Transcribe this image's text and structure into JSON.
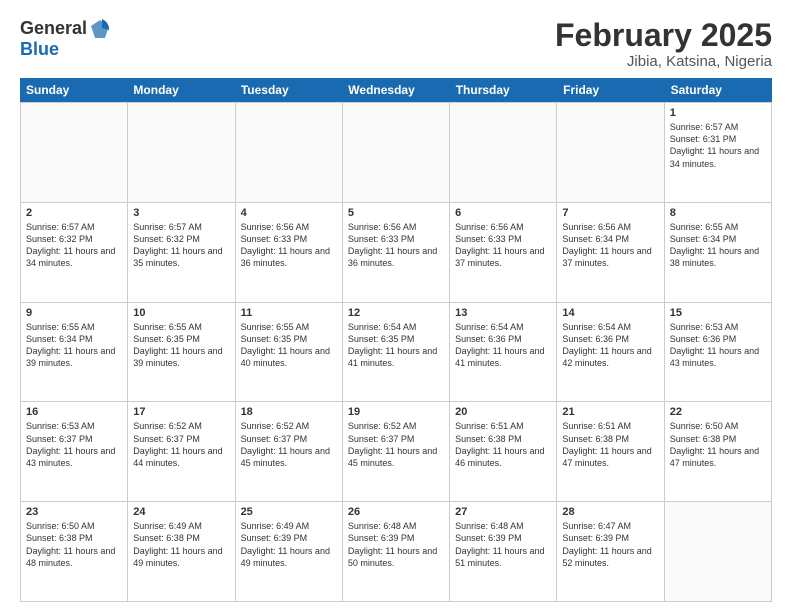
{
  "header": {
    "logo_general": "General",
    "logo_blue": "Blue",
    "month_title": "February 2025",
    "location": "Jibia, Katsina, Nigeria"
  },
  "days_of_week": [
    "Sunday",
    "Monday",
    "Tuesday",
    "Wednesday",
    "Thursday",
    "Friday",
    "Saturday"
  ],
  "weeks": [
    [
      {
        "day": "",
        "empty": true
      },
      {
        "day": "",
        "empty": true
      },
      {
        "day": "",
        "empty": true
      },
      {
        "day": "",
        "empty": true
      },
      {
        "day": "",
        "empty": true
      },
      {
        "day": "",
        "empty": true
      },
      {
        "day": "1",
        "sunrise": "Sunrise: 6:57 AM",
        "sunset": "Sunset: 6:31 PM",
        "daylight": "Daylight: 11 hours and 34 minutes."
      }
    ],
    [
      {
        "day": "2",
        "sunrise": "Sunrise: 6:57 AM",
        "sunset": "Sunset: 6:32 PM",
        "daylight": "Daylight: 11 hours and 34 minutes."
      },
      {
        "day": "3",
        "sunrise": "Sunrise: 6:57 AM",
        "sunset": "Sunset: 6:32 PM",
        "daylight": "Daylight: 11 hours and 35 minutes."
      },
      {
        "day": "4",
        "sunrise": "Sunrise: 6:56 AM",
        "sunset": "Sunset: 6:33 PM",
        "daylight": "Daylight: 11 hours and 36 minutes."
      },
      {
        "day": "5",
        "sunrise": "Sunrise: 6:56 AM",
        "sunset": "Sunset: 6:33 PM",
        "daylight": "Daylight: 11 hours and 36 minutes."
      },
      {
        "day": "6",
        "sunrise": "Sunrise: 6:56 AM",
        "sunset": "Sunset: 6:33 PM",
        "daylight": "Daylight: 11 hours and 37 minutes."
      },
      {
        "day": "7",
        "sunrise": "Sunrise: 6:56 AM",
        "sunset": "Sunset: 6:34 PM",
        "daylight": "Daylight: 11 hours and 37 minutes."
      },
      {
        "day": "8",
        "sunrise": "Sunrise: 6:55 AM",
        "sunset": "Sunset: 6:34 PM",
        "daylight": "Daylight: 11 hours and 38 minutes."
      }
    ],
    [
      {
        "day": "9",
        "sunrise": "Sunrise: 6:55 AM",
        "sunset": "Sunset: 6:34 PM",
        "daylight": "Daylight: 11 hours and 39 minutes."
      },
      {
        "day": "10",
        "sunrise": "Sunrise: 6:55 AM",
        "sunset": "Sunset: 6:35 PM",
        "daylight": "Daylight: 11 hours and 39 minutes."
      },
      {
        "day": "11",
        "sunrise": "Sunrise: 6:55 AM",
        "sunset": "Sunset: 6:35 PM",
        "daylight": "Daylight: 11 hours and 40 minutes."
      },
      {
        "day": "12",
        "sunrise": "Sunrise: 6:54 AM",
        "sunset": "Sunset: 6:35 PM",
        "daylight": "Daylight: 11 hours and 41 minutes."
      },
      {
        "day": "13",
        "sunrise": "Sunrise: 6:54 AM",
        "sunset": "Sunset: 6:36 PM",
        "daylight": "Daylight: 11 hours and 41 minutes."
      },
      {
        "day": "14",
        "sunrise": "Sunrise: 6:54 AM",
        "sunset": "Sunset: 6:36 PM",
        "daylight": "Daylight: 11 hours and 42 minutes."
      },
      {
        "day": "15",
        "sunrise": "Sunrise: 6:53 AM",
        "sunset": "Sunset: 6:36 PM",
        "daylight": "Daylight: 11 hours and 43 minutes."
      }
    ],
    [
      {
        "day": "16",
        "sunrise": "Sunrise: 6:53 AM",
        "sunset": "Sunset: 6:37 PM",
        "daylight": "Daylight: 11 hours and 43 minutes."
      },
      {
        "day": "17",
        "sunrise": "Sunrise: 6:52 AM",
        "sunset": "Sunset: 6:37 PM",
        "daylight": "Daylight: 11 hours and 44 minutes."
      },
      {
        "day": "18",
        "sunrise": "Sunrise: 6:52 AM",
        "sunset": "Sunset: 6:37 PM",
        "daylight": "Daylight: 11 hours and 45 minutes."
      },
      {
        "day": "19",
        "sunrise": "Sunrise: 6:52 AM",
        "sunset": "Sunset: 6:37 PM",
        "daylight": "Daylight: 11 hours and 45 minutes."
      },
      {
        "day": "20",
        "sunrise": "Sunrise: 6:51 AM",
        "sunset": "Sunset: 6:38 PM",
        "daylight": "Daylight: 11 hours and 46 minutes."
      },
      {
        "day": "21",
        "sunrise": "Sunrise: 6:51 AM",
        "sunset": "Sunset: 6:38 PM",
        "daylight": "Daylight: 11 hours and 47 minutes."
      },
      {
        "day": "22",
        "sunrise": "Sunrise: 6:50 AM",
        "sunset": "Sunset: 6:38 PM",
        "daylight": "Daylight: 11 hours and 47 minutes."
      }
    ],
    [
      {
        "day": "23",
        "sunrise": "Sunrise: 6:50 AM",
        "sunset": "Sunset: 6:38 PM",
        "daylight": "Daylight: 11 hours and 48 minutes."
      },
      {
        "day": "24",
        "sunrise": "Sunrise: 6:49 AM",
        "sunset": "Sunset: 6:38 PM",
        "daylight": "Daylight: 11 hours and 49 minutes."
      },
      {
        "day": "25",
        "sunrise": "Sunrise: 6:49 AM",
        "sunset": "Sunset: 6:39 PM",
        "daylight": "Daylight: 11 hours and 49 minutes."
      },
      {
        "day": "26",
        "sunrise": "Sunrise: 6:48 AM",
        "sunset": "Sunset: 6:39 PM",
        "daylight": "Daylight: 11 hours and 50 minutes."
      },
      {
        "day": "27",
        "sunrise": "Sunrise: 6:48 AM",
        "sunset": "Sunset: 6:39 PM",
        "daylight": "Daylight: 11 hours and 51 minutes."
      },
      {
        "day": "28",
        "sunrise": "Sunrise: 6:47 AM",
        "sunset": "Sunset: 6:39 PM",
        "daylight": "Daylight: 11 hours and 52 minutes."
      },
      {
        "day": "",
        "empty": true
      }
    ]
  ]
}
